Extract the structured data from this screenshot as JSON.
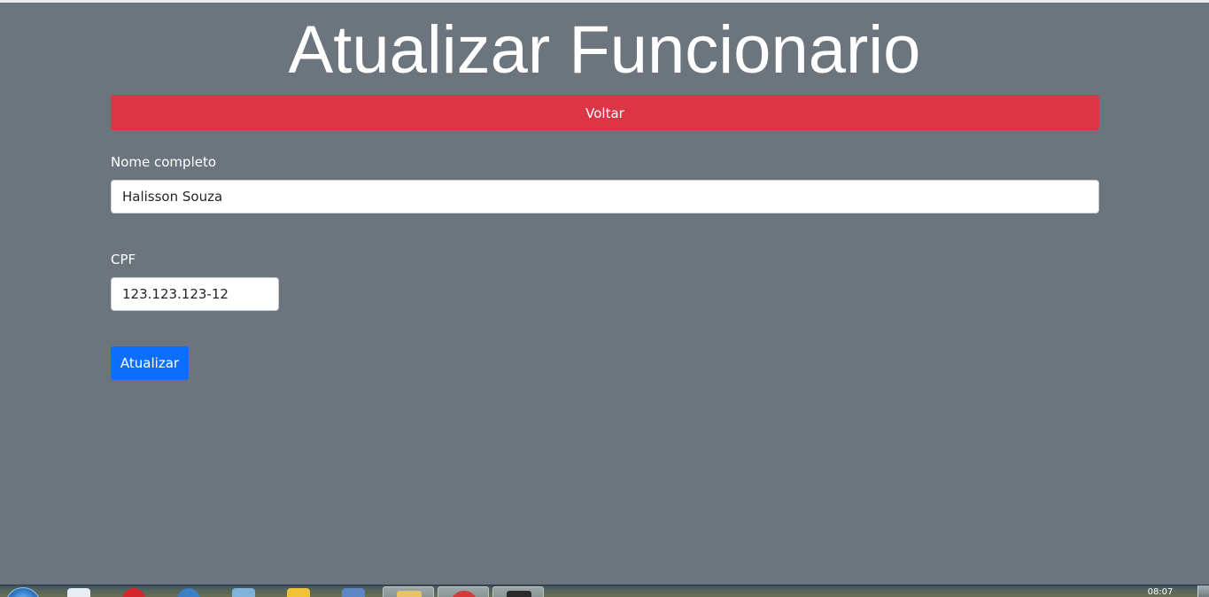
{
  "page": {
    "title": "Atualizar Funcionario",
    "back_button_label": "Voltar"
  },
  "form": {
    "name_label": "Nome completo",
    "name_value": "Halisson Souza",
    "cpf_label": "CPF",
    "cpf_value": "123.123.123-12",
    "submit_label": "Atualizar"
  },
  "taskbar": {
    "clock": "08:07"
  },
  "colors": {
    "background": "#6c757d",
    "danger": "#dc3545",
    "primary": "#0d6efd"
  }
}
